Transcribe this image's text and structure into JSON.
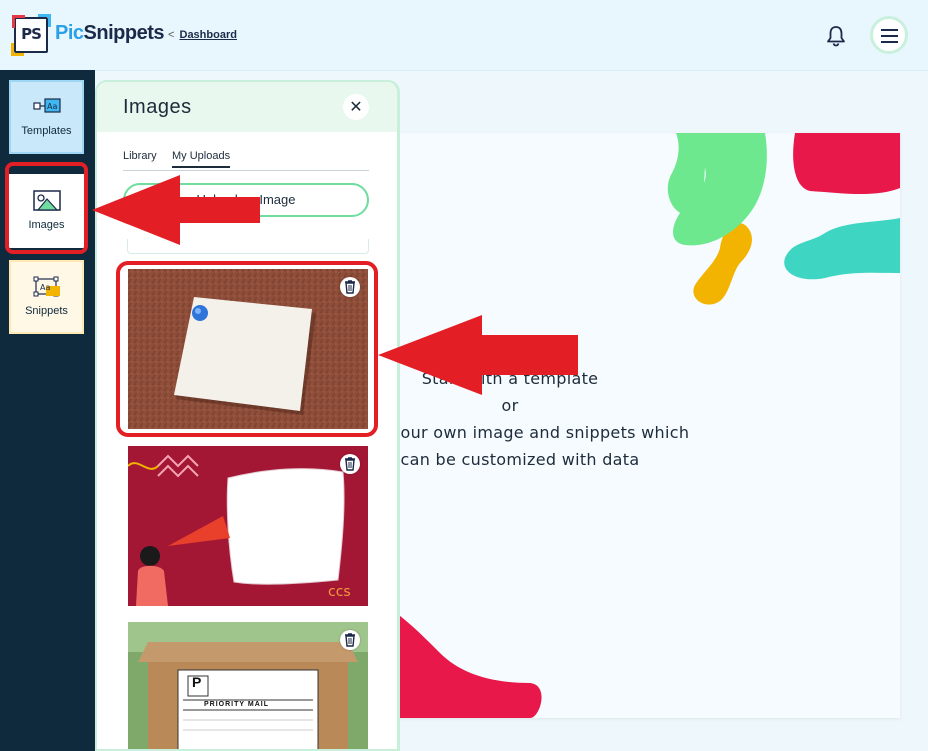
{
  "header": {
    "logo_text": "PS",
    "brand_part1": "Pic",
    "brand_part2": "Snippets",
    "breadcrumb_chevron": "<",
    "breadcrumb_link": "Dashboard"
  },
  "sidebar": {
    "items": [
      {
        "label": "Templates",
        "icon": "template-icon"
      },
      {
        "label": "Images",
        "icon": "image-icon"
      },
      {
        "label": "Snippets",
        "icon": "snippet-icon"
      }
    ]
  },
  "panel": {
    "title": "Images",
    "close_glyph": "✕",
    "tabs": [
      {
        "label": "Library"
      },
      {
        "label": "My Uploads",
        "active": true
      }
    ],
    "upload_button_label": "Upload an Image",
    "thumbnails": [
      {
        "description_icon": "sticky-note-on-corkboard-image"
      },
      {
        "description_icon": "megaphone-woman-banner-image"
      },
      {
        "description_icon": "priority-mail-box-image"
      }
    ],
    "priority_mail_label": "PRIORITY MAIL",
    "priority_letter": "P"
  },
  "canvas": {
    "line1": "Start with a template",
    "line2": "or",
    "line3": "your own image and snippets which",
    "line4": "can be customized with data"
  },
  "colors": {
    "accent_green": "#6fdd9e",
    "annotation_red": "#e31e24",
    "rail_bg": "#0e2a3c",
    "brand_blue": "#2aa0e8"
  }
}
